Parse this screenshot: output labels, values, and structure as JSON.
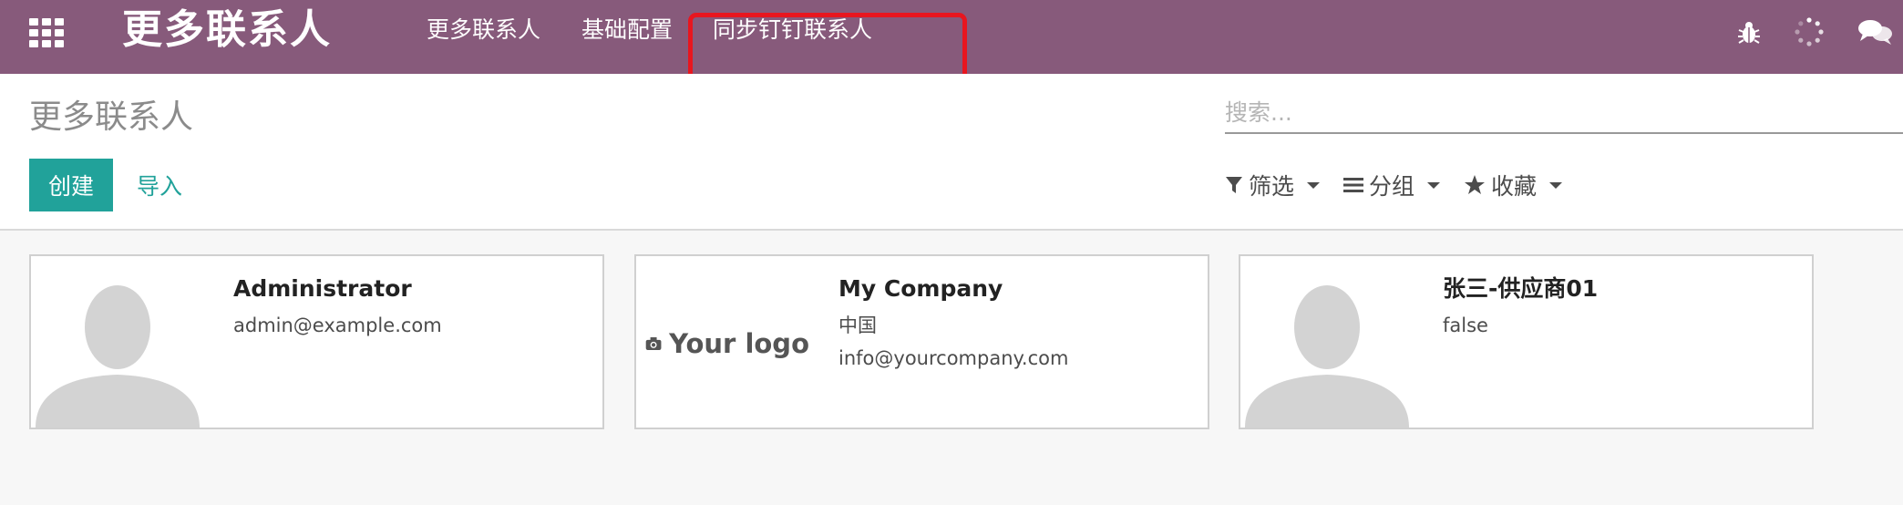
{
  "navbar": {
    "brand": "更多联系人",
    "menu": [
      "更多联系人",
      "基础配置",
      "同步钉钉联系人"
    ],
    "icons": [
      "apps-grid-icon",
      "bug-icon",
      "activity-spinner-icon",
      "chat-icon"
    ],
    "bg_color": "#875a7b",
    "highlight_color": "#e8161f"
  },
  "control_panel": {
    "title": "更多联系人",
    "search_placeholder": "搜索...",
    "create_label": "创建",
    "import_label": "导入",
    "filter_label": "筛选",
    "group_label": "分组",
    "favorites_label": "收藏",
    "accent_color": "#21a29a"
  },
  "cards": [
    {
      "title": "Administrator",
      "lines": [
        "admin@example.com"
      ],
      "image": "avatar-placeholder-icon"
    },
    {
      "title": "My Company",
      "lines": [
        "中国",
        "info@yourcompany.com"
      ],
      "image": "company-logo",
      "logo_text": "Your logo"
    },
    {
      "title": "张三-供应商01",
      "lines": [
        "false"
      ],
      "image": "avatar-placeholder-icon"
    }
  ]
}
